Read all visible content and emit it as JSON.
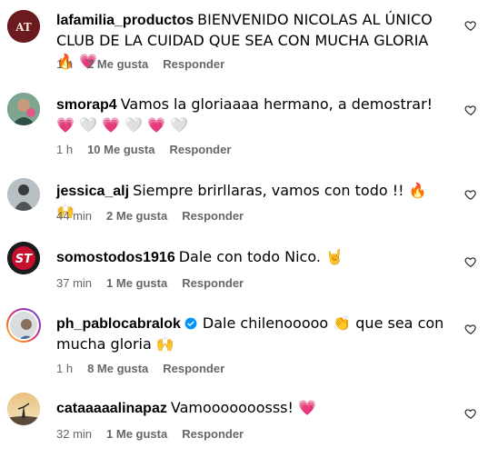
{
  "comments": [
    {
      "username": "lafamilia_productos",
      "text": "BIENVENIDO NICOLAS AL ÚNICO CLUB DE LA CUIDAD QUE SEA CON MUCHA GLORIA 🔥 💗",
      "time": "1 h",
      "likes": "2 Me gusta",
      "reply": "Responder"
    },
    {
      "username": "smorap4",
      "text": "Vamos la gloriaaaa hermano, a demostrar! 💗 🤍 💗 🤍 💗 🤍",
      "time": "1 h",
      "likes": "10 Me gusta",
      "reply": "Responder"
    },
    {
      "username": "jessica_alj",
      "text": "Siempre brirllaras, vamos con todo !! 🔥 🙌",
      "time": "44 min",
      "likes": "2 Me gusta",
      "reply": "Responder"
    },
    {
      "username": "somostodos1916",
      "text": "Dale con todo Nico. 🤘",
      "time": "37 min",
      "likes": "1 Me gusta",
      "reply": "Responder"
    },
    {
      "username": "ph_pablocabralok",
      "text": "Dale chilenooooo 👏 que sea con mucha gloria 🙌",
      "time": "1 h",
      "likes": "8 Me gusta",
      "reply": "Responder"
    },
    {
      "username": "cataaaaalinapaz",
      "text": "Vamooooooosss! 💗",
      "time": "32 min",
      "likes": "1 Me gusta",
      "reply": "Responder"
    }
  ],
  "avatar_badges": {
    "lafamilia": "AT",
    "somostodos": "ST"
  },
  "colors": {
    "meta_text": "#65676b",
    "verified": "#0095f6",
    "somostodos_bg": "#c8102e"
  }
}
